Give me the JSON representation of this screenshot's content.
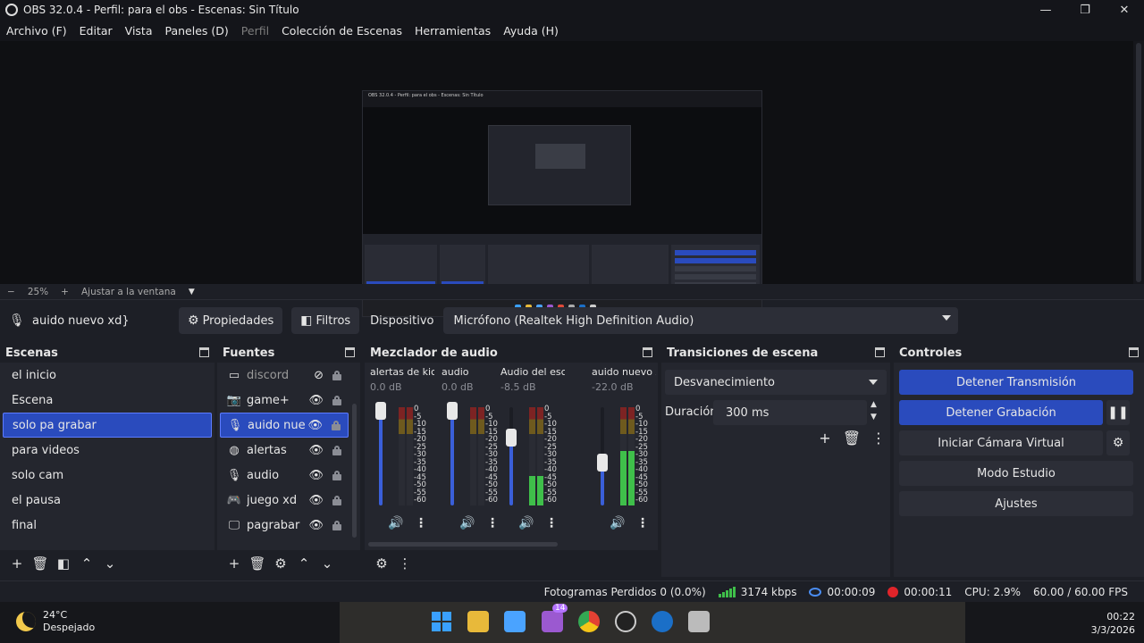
{
  "window": {
    "title": "OBS 32.0.4 - Perfil: para el obs - Escenas: Sin Título",
    "minimize": "—",
    "restore": "❐",
    "close": "✕"
  },
  "menu": [
    "Archivo (F)",
    "Editar",
    "Vista",
    "Paneles (D)",
    "Perfil",
    "Colección de Escenas",
    "Herramientas",
    "Ayuda (H)"
  ],
  "zoom": {
    "minus": "−",
    "value": "25%",
    "plus": "+",
    "fit": "Ajustar a la ventana"
  },
  "source_toolbar": {
    "selected_source": "auido nuevo xd}",
    "properties": "Propiedades",
    "filters": "Filtros",
    "device_label": "Dispositivo",
    "device_value": "Micrófono (Realtek High Definition Audio)"
  },
  "scenes": {
    "title": "Escenas",
    "items": [
      "el inicio",
      "Escena",
      "solo pa grabar",
      "para videos",
      "solo cam",
      "el pausa",
      "final"
    ],
    "selected_index": 2
  },
  "sources": {
    "title": "Fuentes",
    "items": [
      {
        "name": "discord",
        "icon": "window-capture-icon",
        "visible": false
      },
      {
        "name": "game+",
        "icon": "camera-icon",
        "visible": true
      },
      {
        "name": "auido nuevo xd}",
        "icon": "mic-icon",
        "visible": true,
        "selected": true
      },
      {
        "name": "alertas",
        "icon": "globe-icon",
        "visible": true
      },
      {
        "name": "audio",
        "icon": "mic-icon",
        "visible": true
      },
      {
        "name": "juego xd",
        "icon": "game-capture-icon",
        "visible": true
      },
      {
        "name": "pagrabar",
        "icon": "monitor-icon",
        "visible": true
      }
    ]
  },
  "mixer": {
    "title": "Mezclador de audio",
    "ticks": [
      "0",
      "-5",
      "-10",
      "-15",
      "-20",
      "-25",
      "-30",
      "-35",
      "-40",
      "-45",
      "-50",
      "-55",
      "-60"
    ],
    "channels": [
      {
        "name": "alertas de kick",
        "db": "0.0 dB",
        "volume": 1.0,
        "level": 0.0
      },
      {
        "name": "audio",
        "db": "0.0 dB",
        "volume": 1.0,
        "level": 0.0
      },
      {
        "name": "Audio del escritorio",
        "db": "-8.5 dB",
        "volume": 0.72,
        "level": 0.3
      },
      {
        "name": "auido nuevo xd}",
        "db": "-22.0 dB",
        "volume": 0.45,
        "level": 0.55
      }
    ]
  },
  "transitions": {
    "title": "Transiciones de escena",
    "selected": "Desvanecimiento",
    "duration_label": "Duración",
    "duration_value": "300 ms"
  },
  "controls": {
    "title": "Controles",
    "stop_stream": "Detener Transmisión",
    "stop_record": "Detener Grabación",
    "virtual_cam": "Iniciar Cámara Virtual",
    "studio_mode": "Modo Estudio",
    "settings": "Ajustes"
  },
  "status": {
    "dropped_frames": "Fotogramas Perdidos 0 (0.0%)",
    "bitrate": "3174 kbps",
    "stream_time": "00:00:09",
    "record_time": "00:00:11",
    "cpu": "CPU: 2.9%",
    "fps": "60.00 / 60.00 FPS"
  },
  "taskbar": {
    "temperature": "24°C",
    "weather": "Despejado",
    "badge": "14",
    "time": "00:22",
    "date": "3/3/2026"
  },
  "colors": {
    "accent": "#2a4bbd",
    "panel": "#24262e",
    "background": "#1d1f26",
    "meter_green": "#3fbf4a",
    "record_red": "#e0242a"
  }
}
